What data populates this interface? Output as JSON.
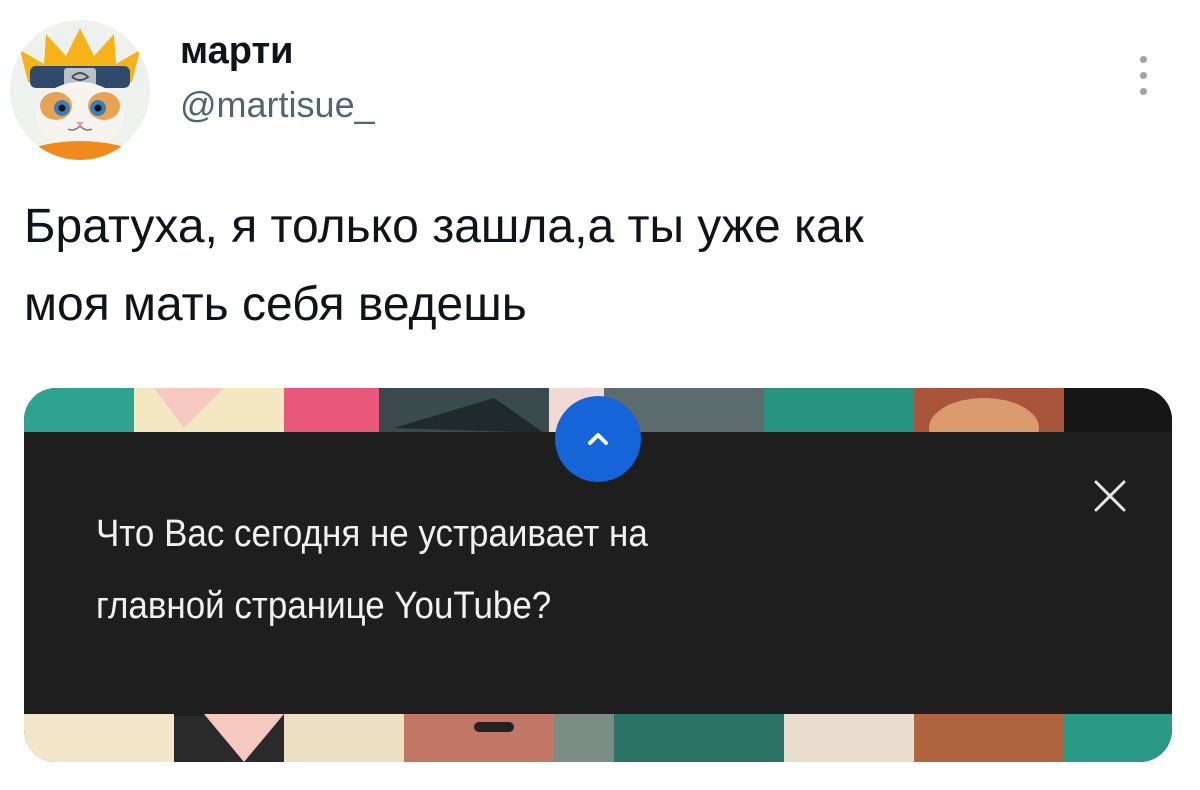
{
  "tweet": {
    "author": {
      "display_name": "марти",
      "handle": "@martisue_"
    },
    "text_lines": [
      "Братуха, я только зашла,а ты уже как",
      "моя мать себя ведешь"
    ]
  },
  "embedded_screenshot": {
    "prompt_lines": [
      "Что Вас сегодня не устраивает на",
      "главной странице YouTube?"
    ],
    "icons": {
      "expand": "chevron-up-icon",
      "close": "close-icon",
      "more": "more-vertical-icon"
    }
  },
  "colors": {
    "accent_blue": "#1565d8",
    "panel_dark": "#1e1e1e",
    "handle_gray": "#536471"
  }
}
